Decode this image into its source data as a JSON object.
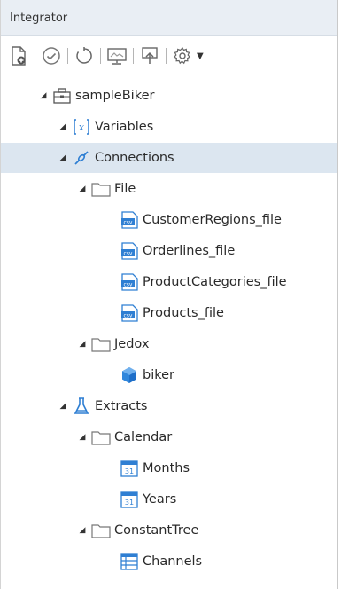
{
  "panel": {
    "title": "Integrator"
  },
  "toolbar": {
    "buttons": [
      {
        "icon": "new-project-icon"
      },
      {
        "icon": "validate-icon"
      },
      {
        "icon": "refresh-icon"
      },
      {
        "icon": "monitor-icon"
      },
      {
        "icon": "upload-icon"
      },
      {
        "icon": "settings-icon"
      }
    ]
  },
  "tree": {
    "items": [
      {
        "label": "sampleBiker",
        "icon": "project-icon",
        "level": 0,
        "expanded": true
      },
      {
        "label": "Variables",
        "icon": "variables-icon",
        "level": 1,
        "expanded": true
      },
      {
        "label": "Connections",
        "icon": "connections-icon",
        "level": 1,
        "expanded": true,
        "selected": true
      },
      {
        "label": "File",
        "icon": "folder-icon",
        "level": 2,
        "expanded": true
      },
      {
        "label": "CustomerRegions_file",
        "icon": "csv-file-icon",
        "level": 3
      },
      {
        "label": "Orderlines_file",
        "icon": "csv-file-icon",
        "level": 3
      },
      {
        "label": "ProductCategories_file",
        "icon": "csv-file-icon",
        "level": 3
      },
      {
        "label": "Products_file",
        "icon": "csv-file-icon",
        "level": 3
      },
      {
        "label": "Jedox",
        "icon": "folder-icon",
        "level": 2,
        "expanded": true
      },
      {
        "label": "biker",
        "icon": "jedox-cube-icon",
        "level": 3
      },
      {
        "label": "Extracts",
        "icon": "extracts-flask-icon",
        "level": 1,
        "expanded": true
      },
      {
        "label": "Calendar",
        "icon": "folder-icon",
        "level": 2,
        "expanded": true
      },
      {
        "label": "Months",
        "icon": "calendar-icon",
        "level": 3
      },
      {
        "label": "Years",
        "icon": "calendar-icon",
        "level": 3
      },
      {
        "label": "ConstantTree",
        "icon": "folder-icon",
        "level": 2,
        "expanded": true
      },
      {
        "label": "Channels",
        "icon": "tree-table-icon",
        "level": 3
      }
    ]
  },
  "colors": {
    "selection": "#dce6f0",
    "header": "#e9eef4",
    "icon_blue": "#2f7fd3"
  }
}
